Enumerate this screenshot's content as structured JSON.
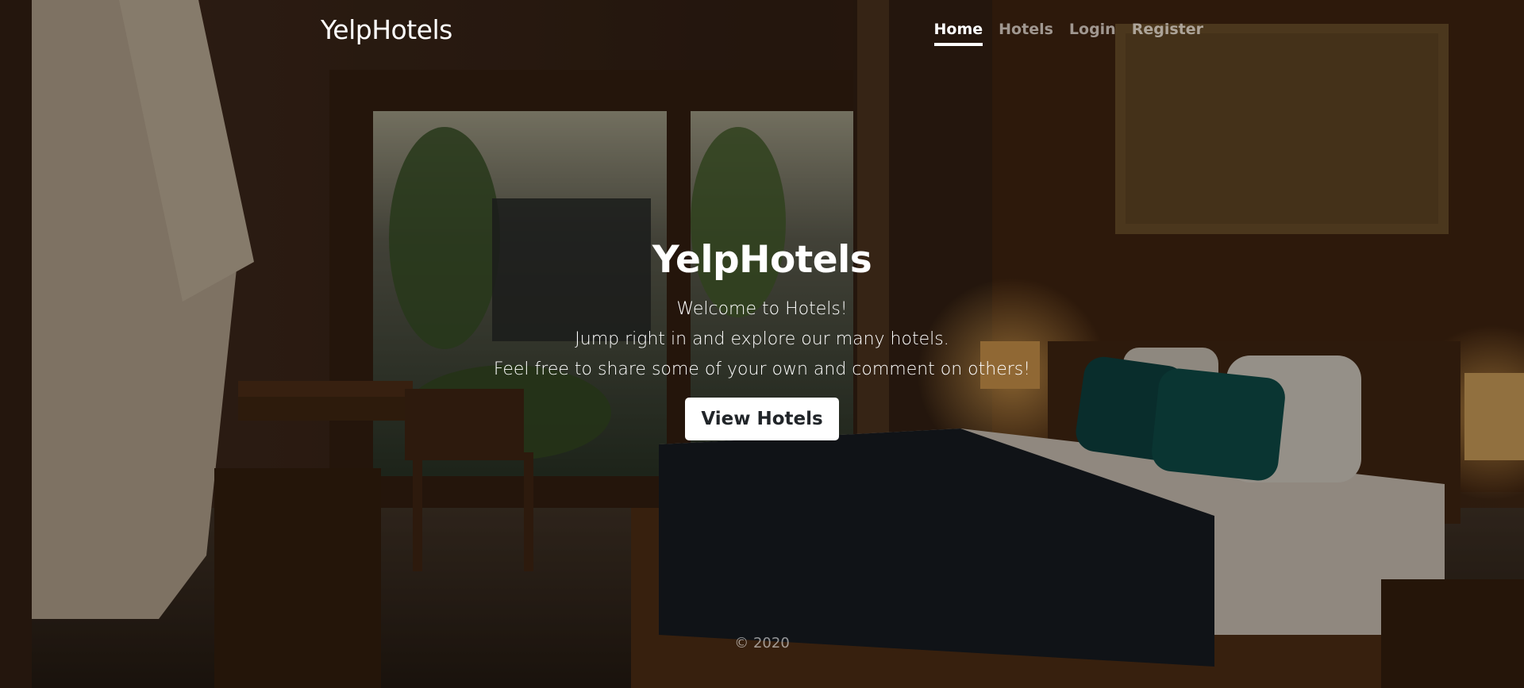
{
  "header": {
    "brand": "YelpHotels",
    "nav": [
      {
        "label": "Home",
        "active": true
      },
      {
        "label": "Hotels",
        "active": false
      },
      {
        "label": "Login",
        "active": false
      },
      {
        "label": "Register",
        "active": false
      }
    ]
  },
  "hero": {
    "title": "YelpHotels",
    "lines": [
      "Welcome to Hotels!",
      "Jump right in and explore our many hotels.",
      "Feel free to share some of your own and comment on others!"
    ],
    "button_label": "View Hotels"
  },
  "footer": {
    "copyright": "© 2020"
  },
  "colors": {
    "overlay": "#000000",
    "text": "#ffffff",
    "muted_text": "#8c8c8c",
    "button_bg": "#ffffff",
    "button_text": "#212529"
  }
}
